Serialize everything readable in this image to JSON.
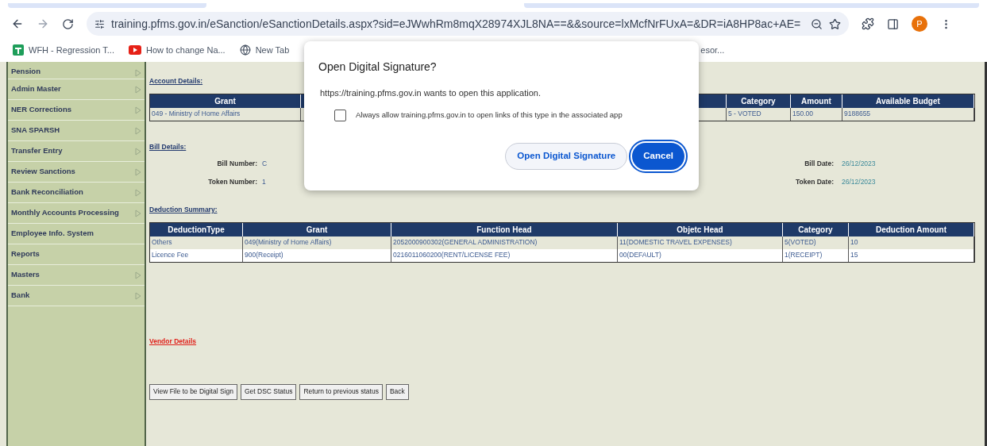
{
  "browser": {
    "url": "training.pfms.gov.in/eSanction/eSanctionDetails.aspx?sid=eJWwhRm8mqX28974XJL8NA==&&source=lxMcfNrFUxA=&DR=iA8HP8ac+AE=",
    "profile_initial": "P",
    "bookmarks": [
      {
        "label": "WFH - Regression T...",
        "kind": "sheet"
      },
      {
        "label": "How to change Na...",
        "kind": "video"
      },
      {
        "label": "New Tab",
        "kind": "globe"
      },
      {
        "label": "esor...",
        "kind": "partial"
      }
    ]
  },
  "sidebar": {
    "items": [
      {
        "label": "Pension",
        "has_submenu": true
      },
      {
        "label": "Admin Master",
        "has_submenu": true
      },
      {
        "label": "NER Corrections",
        "has_submenu": true
      },
      {
        "label": "SNA SPARSH",
        "has_submenu": true
      },
      {
        "label": "Transfer Entry",
        "has_submenu": true
      },
      {
        "label": "Review Sanctions",
        "has_submenu": true
      },
      {
        "label": "Bank Reconciliation",
        "has_submenu": true
      },
      {
        "label": "Monthly Accounts Processing",
        "has_submenu": true
      },
      {
        "label": "Employee Info. System",
        "has_submenu": false
      },
      {
        "label": "Reports",
        "has_submenu": false
      },
      {
        "label": "Masters",
        "has_submenu": true
      },
      {
        "label": "Bank",
        "has_submenu": true
      }
    ]
  },
  "account_details": {
    "heading": "Account Details:",
    "columns": [
      "Grant",
      "",
      "Category",
      "Amount",
      "Available Budget"
    ],
    "rows": [
      [
        "049 - Ministry of Home Affairs",
        "",
        "5 - VOTED",
        "150.00",
        "9188655"
      ]
    ]
  },
  "bill_details": {
    "heading": "Bill Details:",
    "fields": [
      {
        "label": "Bill Number:",
        "value": "C",
        "date_label": "Bill Date:",
        "date": "26/12/2023"
      },
      {
        "label": "Token Number:",
        "value": "1",
        "date_label": "Token Date:",
        "date": "26/12/2023"
      }
    ]
  },
  "deduction_summary": {
    "heading": "Deduction Summary:",
    "columns": [
      "DeductionType",
      "Grant",
      "Function Head",
      "Objetc Head",
      "Category",
      "Deduction Amount"
    ],
    "rows": [
      [
        "Others",
        "049(Ministry of Home Affairs)",
        "2052000900302(GENERAL ADMINISTRATION)",
        "11(DOMESTIC TRAVEL EXPENSES)",
        "5(VOTED)",
        "10"
      ],
      [
        "Licence Fee",
        "900(Receipt)",
        "0216011060200(RENT/LICENSE FEE)",
        "00(DEFAULT)",
        "1(RECEIPT)",
        "15"
      ]
    ]
  },
  "vendor_link": "Vendor Details",
  "actions": [
    "View File to be Digital Sign",
    "Get DSC Status",
    "Return to previous status",
    "Back"
  ],
  "dialog": {
    "title": "Open Digital Signature?",
    "message": "https://training.pfms.gov.in wants to open this application.",
    "checkbox": {
      "label": "Always allow training.pfms.gov.in to open links of this type in the associated app",
      "checked": false
    },
    "buttons": [
      {
        "label": "Open Digital Signature",
        "kind": "secondary"
      },
      {
        "label": "Cancel",
        "kind": "primary"
      }
    ]
  }
}
